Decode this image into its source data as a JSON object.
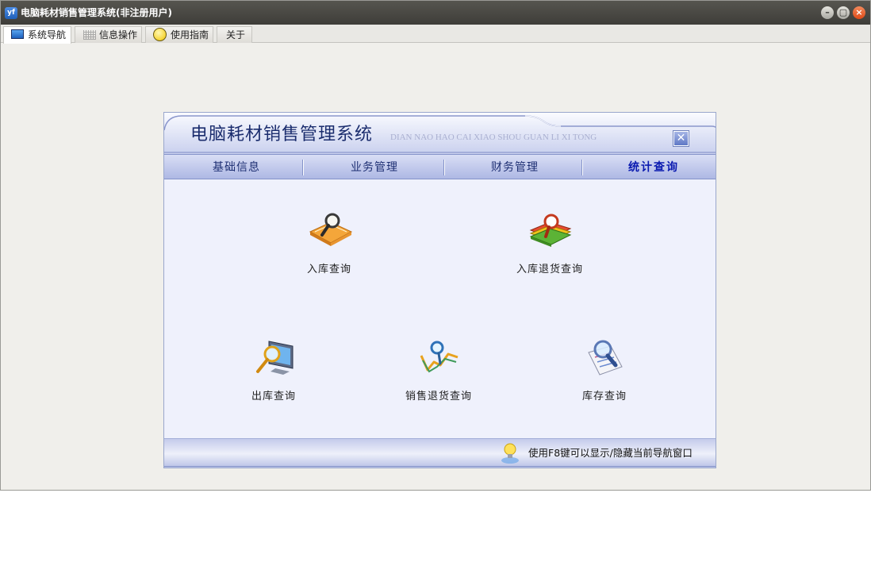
{
  "window": {
    "title": "电脑耗材销售管理系统(非注册用户)",
    "app_icon_text": "yf",
    "minimize_glyph": "–",
    "maximize_glyph": "▢",
    "close_glyph": "×"
  },
  "tabs": [
    {
      "label": "系统导航",
      "icon": "monitor-icon",
      "active": true
    },
    {
      "label": "信息操作",
      "icon": "grid-icon",
      "active": false
    },
    {
      "label": "使用指南",
      "icon": "help-icon",
      "active": false
    },
    {
      "label": "关于",
      "icon": "",
      "active": false
    }
  ],
  "panel": {
    "title": "电脑耗材销售管理系统",
    "pinyin": "DIAN NAO HAO CAI XIAO SHOU GUAN LI XI TONG",
    "close_glyph": "✕",
    "menu": [
      {
        "label": "基础信息",
        "active": false
      },
      {
        "label": "业务管理",
        "active": false
      },
      {
        "label": "财务管理",
        "active": false
      },
      {
        "label": "统计查询",
        "active": true
      }
    ],
    "items": [
      {
        "label": "入库查询",
        "icon": "magnifier-book-icon"
      },
      {
        "label": "入库退货查询",
        "icon": "books-magnifier-icon"
      },
      {
        "label": "出库查询",
        "icon": "monitor-magnifier-icon"
      },
      {
        "label": "销售退货查询",
        "icon": "chart-magnifier-icon"
      },
      {
        "label": "库存查询",
        "icon": "document-magnifier-icon"
      }
    ],
    "hint": "使用F8键可以显示/隐藏当前导航窗口",
    "hint_icon": "lightbulb-icon"
  },
  "colors": {
    "titlebar": "#3e3d39",
    "panel_bg": "#eff1fc",
    "menu_text": "#1e2f73",
    "menu_active_text": "#0a1ab0"
  }
}
